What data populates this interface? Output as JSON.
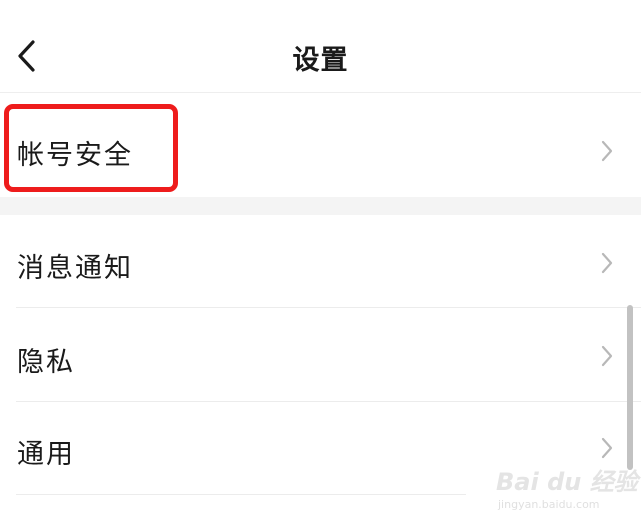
{
  "header": {
    "title": "设置",
    "back_icon": "chevron-left-icon"
  },
  "settings": {
    "items": [
      {
        "label": "帐号安全",
        "icon": "chevron-right-icon",
        "highlighted": true
      },
      {
        "label": "消息通知",
        "icon": "chevron-right-icon"
      },
      {
        "label": "隐私",
        "icon": "chevron-right-icon"
      },
      {
        "label": "通用",
        "icon": "chevron-right-icon"
      }
    ]
  },
  "watermark": {
    "brand": "Bai du 经验",
    "url": "jingyan.baidu.com"
  },
  "colors": {
    "highlight": "#ee1c1c",
    "section_gap": "#f4f4f4",
    "chevron": "#b8b8b8",
    "text": "#1a1a1a"
  }
}
